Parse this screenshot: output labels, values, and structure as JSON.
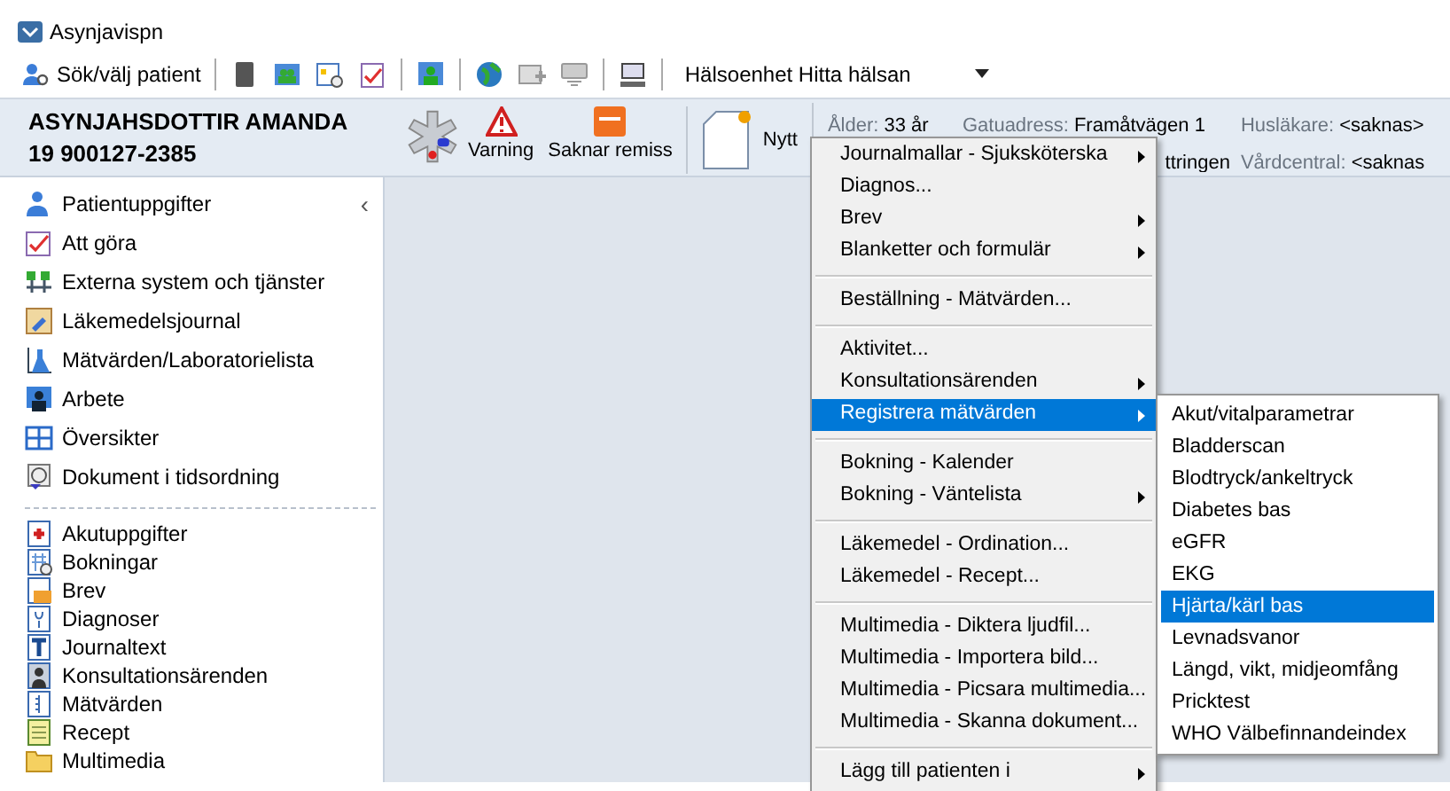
{
  "window": {
    "title": "Asynjavispn"
  },
  "toolbar": {
    "search_button": "Sök/välj patient",
    "unit_select": "Hälsoenhet Hitta hälsan"
  },
  "patient": {
    "name": "ASYNJAHSDOTTIR AMANDA",
    "id": "19 900127-2385",
    "actions": [
      "Varning",
      "Saknar remiss",
      "Nytt"
    ],
    "info": [
      {
        "label": "Ålder:",
        "value": "33 år"
      },
      {
        "label": "Gatuadress:",
        "value": "Framåtvägen 1"
      },
      {
        "label": "Husläkare:",
        "value": "<saknas>"
      },
      {
        "value": "ttringen"
      },
      {
        "label": "Vårdcentral:",
        "value": "<saknas"
      }
    ]
  },
  "sidebar": {
    "items": [
      {
        "label": "Patientuppgifter",
        "collapse": "‹"
      },
      {
        "label": "Att göra"
      },
      {
        "label": "Externa system och tjänster"
      },
      {
        "label": "Läkemedelsjournal"
      },
      {
        "label": "Mätvärden/Laboratorielista"
      },
      {
        "label": "Arbete"
      },
      {
        "label": "Översikter"
      },
      {
        "label": "Dokument i tidsordning"
      }
    ],
    "documents": [
      "Akutuppgifter",
      "Bokningar",
      "Brev",
      "Diagnoser",
      "Journaltext",
      "Konsultationsärenden",
      "Mätvärden",
      "Recept",
      "Multimedia"
    ]
  },
  "menu": {
    "groups": [
      [
        {
          "label": "Journalmallar - Sjuksköterska",
          "submenu": true,
          "selected": false
        },
        {
          "label": "Diagnos...",
          "submenu": false,
          "selected": false
        },
        {
          "label": "Brev",
          "submenu": true,
          "selected": false
        },
        {
          "label": "Blanketter och formulär",
          "submenu": true,
          "selected": false
        }
      ],
      [
        {
          "label": "Beställning - Mätvärden...",
          "submenu": false,
          "selected": false
        }
      ],
      [
        {
          "label": "Aktivitet...",
          "submenu": false,
          "selected": false
        },
        {
          "label": "Konsultationsärenden",
          "submenu": true,
          "selected": false
        },
        {
          "label": "Registrera mätvärden",
          "submenu": true,
          "selected": true
        }
      ],
      [
        {
          "label": "Bokning - Kalender",
          "submenu": false,
          "selected": false
        },
        {
          "label": "Bokning - Väntelista",
          "submenu": true,
          "selected": false
        }
      ],
      [
        {
          "label": "Läkemedel - Ordination...",
          "submenu": false,
          "selected": false
        },
        {
          "label": "Läkemedel - Recept...",
          "submenu": false,
          "selected": false
        }
      ],
      [
        {
          "label": "Multimedia - Diktera ljudfil...",
          "submenu": false,
          "selected": false
        },
        {
          "label": "Multimedia - Importera bild...",
          "submenu": false,
          "selected": false
        },
        {
          "label": "Multimedia - Picsara multimedia...",
          "submenu": false,
          "selected": false
        },
        {
          "label": "Multimedia - Skanna dokument...",
          "submenu": false,
          "selected": false
        }
      ],
      [
        {
          "label": "Lägg till patienten i",
          "submenu": true,
          "selected": false
        }
      ]
    ],
    "submenu": [
      {
        "label": "Akut/vitalparametrar",
        "selected": false
      },
      {
        "label": "Bladderscan",
        "selected": false
      },
      {
        "label": "Blodtryck/ankeltryck",
        "selected": false
      },
      {
        "label": "Diabetes bas",
        "selected": false
      },
      {
        "label": "eGFR",
        "selected": false
      },
      {
        "label": "EKG",
        "selected": false
      },
      {
        "label": "Hjärta/kärl bas",
        "selected": true
      },
      {
        "label": "Levnadsvanor",
        "selected": false
      },
      {
        "label": "Längd, vikt, midjeomfång",
        "selected": false
      },
      {
        "label": "Pricktest",
        "selected": false
      },
      {
        "label": "WHO Välbefinnandeindex",
        "selected": false
      }
    ]
  }
}
